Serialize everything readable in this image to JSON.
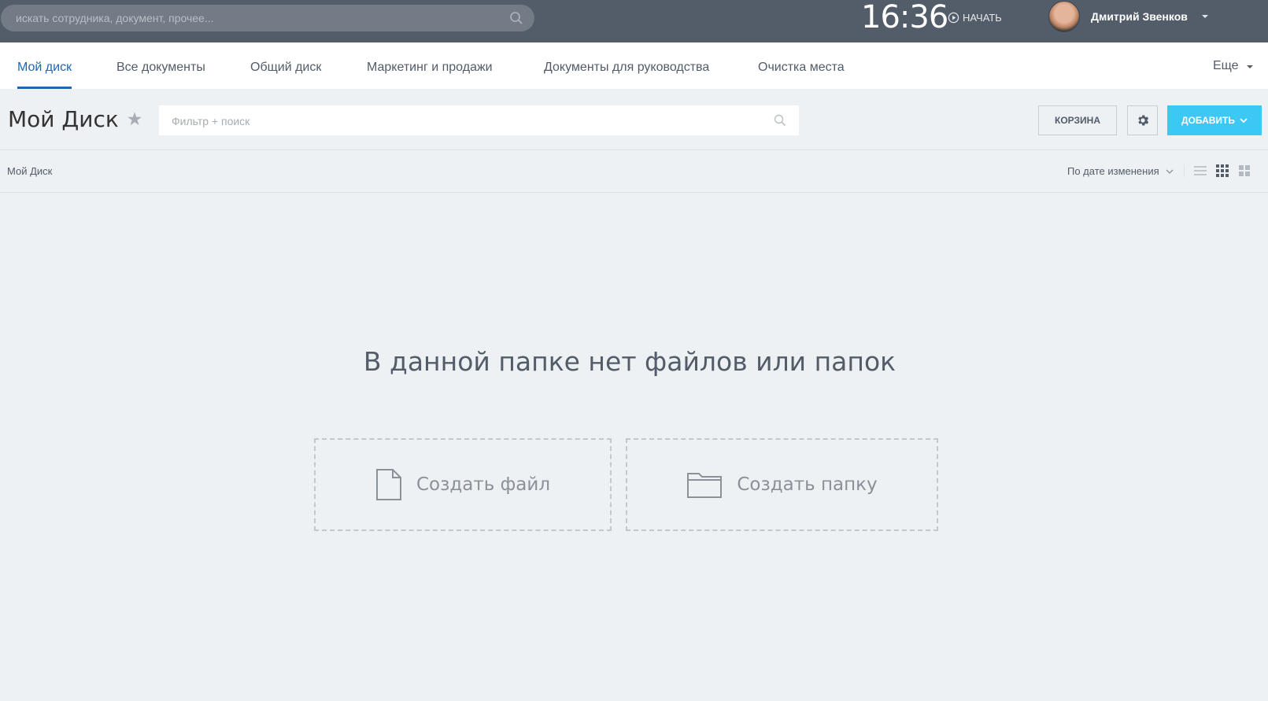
{
  "header": {
    "search_placeholder": "искать сотрудника, документ, прочее...",
    "clock": "16:36",
    "start_label": "НАЧАТЬ",
    "user_name": "Дмитрий Звенков"
  },
  "tabs": [
    {
      "label": "Мой диск",
      "active": true
    },
    {
      "label": "Все документы"
    },
    {
      "label": "Общий диск"
    },
    {
      "label": "Маркетинг и продажи"
    },
    {
      "label": "Документы для руководства"
    },
    {
      "label": "Очистка места"
    }
  ],
  "more_label": "Еще",
  "toolbar": {
    "title": "Мой Диск",
    "filter_placeholder": "Фильтр + поиск",
    "trash_label": "КОРЗИНА",
    "add_label": "ДОБАВИТЬ"
  },
  "breadcrumb": "Мой Диск",
  "sort_label": "По дате изменения",
  "empty": {
    "message": "В данной папке нет файлов или папок",
    "create_file": "Создать файл",
    "create_folder": "Создать папку"
  },
  "colors": {
    "header_bg": "#535c69",
    "accent_blue": "#2067b0",
    "add_button": "#3bc8f5",
    "page_bg": "#edf1f4"
  },
  "icons": [
    "search-icon",
    "play-icon",
    "star-icon",
    "gear-icon",
    "chevron-down-icon",
    "list-view-icon",
    "grid-view-icon",
    "tile-view-icon",
    "file-icon",
    "folder-icon"
  ]
}
